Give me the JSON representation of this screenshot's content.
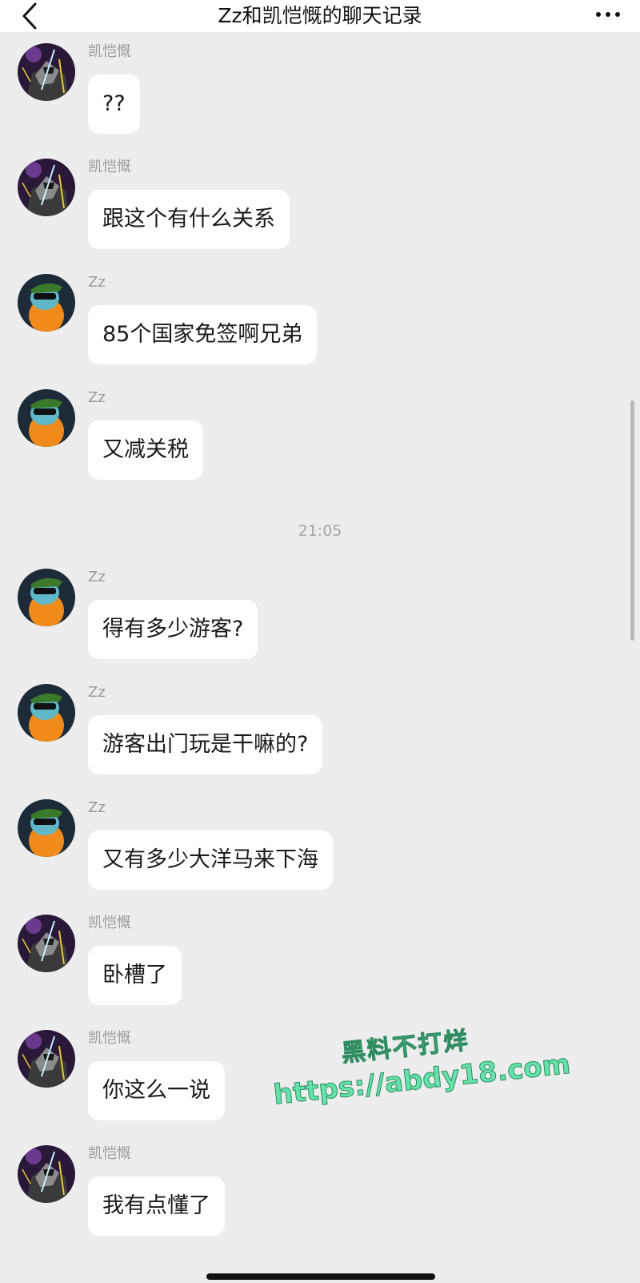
{
  "header": {
    "title": "Zz和凯恺慨的聊天记录"
  },
  "messages": [
    {
      "sender": "凯恺慨",
      "text": "??",
      "avatar": "ninja-avatar"
    },
    {
      "sender": "凯恺慨",
      "text": "跟这个有什么关系",
      "avatar": "ninja-avatar"
    },
    {
      "sender": "Zz",
      "text": "85个国家免签啊兄弟",
      "avatar": "turtle-avatar"
    },
    {
      "sender": "Zz",
      "text": "又减关税",
      "avatar": "turtle-avatar"
    },
    {
      "sender": "Zz",
      "text": "得有多少游客?",
      "avatar": "turtle-avatar"
    },
    {
      "sender": "Zz",
      "text": "游客出门玩是干嘛的?",
      "avatar": "turtle-avatar"
    },
    {
      "sender": "Zz",
      "text": "又有多少大洋马来下海",
      "avatar": "turtle-avatar"
    },
    {
      "sender": "凯恺慨",
      "text": "卧槽了",
      "avatar": "ninja-avatar"
    },
    {
      "sender": "凯恺慨",
      "text": "你这么一说",
      "avatar": "ninja-avatar"
    },
    {
      "sender": "凯恺慨",
      "text": "我有点懂了",
      "avatar": "ninja-avatar"
    }
  ],
  "timestamp": "21:05",
  "watermark": {
    "line1": "黑料不打烊",
    "line2": "https://abdy18.com"
  },
  "colors": {
    "background": "#ededed",
    "bubble": "#ffffff",
    "watermark": "#63e3a9"
  }
}
